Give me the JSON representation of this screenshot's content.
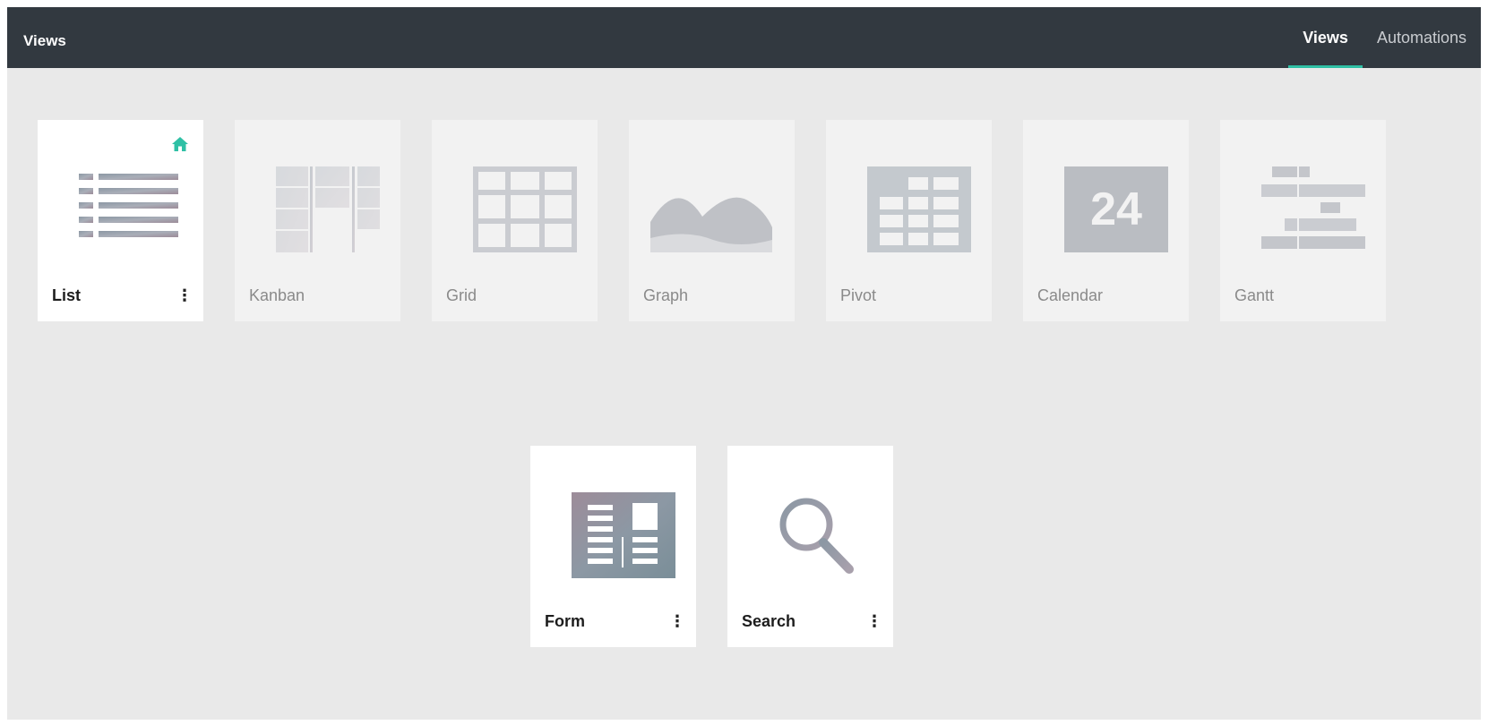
{
  "app": {
    "title": "Views"
  },
  "tabs": [
    {
      "label": "Views",
      "active": true
    },
    {
      "label": "Automations",
      "active": false
    }
  ],
  "views": [
    {
      "label": "List",
      "enabled": true,
      "has_menu": true,
      "is_default": true,
      "icon": "list-view-icon"
    },
    {
      "label": "Kanban",
      "enabled": false,
      "has_menu": false,
      "icon": "kanban-view-icon"
    },
    {
      "label": "Grid",
      "enabled": false,
      "has_menu": false,
      "icon": "grid-view-icon"
    },
    {
      "label": "Graph",
      "enabled": false,
      "has_menu": false,
      "icon": "graph-view-icon"
    },
    {
      "label": "Pivot",
      "enabled": false,
      "has_menu": false,
      "icon": "pivot-view-icon"
    },
    {
      "label": "Calendar",
      "enabled": false,
      "has_menu": false,
      "icon": "calendar-view-icon",
      "calendar_day": "24"
    },
    {
      "label": "Gantt",
      "enabled": false,
      "has_menu": false,
      "icon": "gantt-view-icon"
    },
    {
      "label": "Form",
      "enabled": true,
      "has_menu": true,
      "icon": "form-view-icon"
    },
    {
      "label": "Search",
      "enabled": true,
      "has_menu": true,
      "icon": "search-view-icon"
    }
  ],
  "menu_glyph": "⋮",
  "colors": {
    "topbar": "#323940",
    "accent": "#2fc0a5",
    "background": "#e9e9e9",
    "card_enabled": "#ffffff",
    "card_disabled": "#f2f2f2"
  }
}
